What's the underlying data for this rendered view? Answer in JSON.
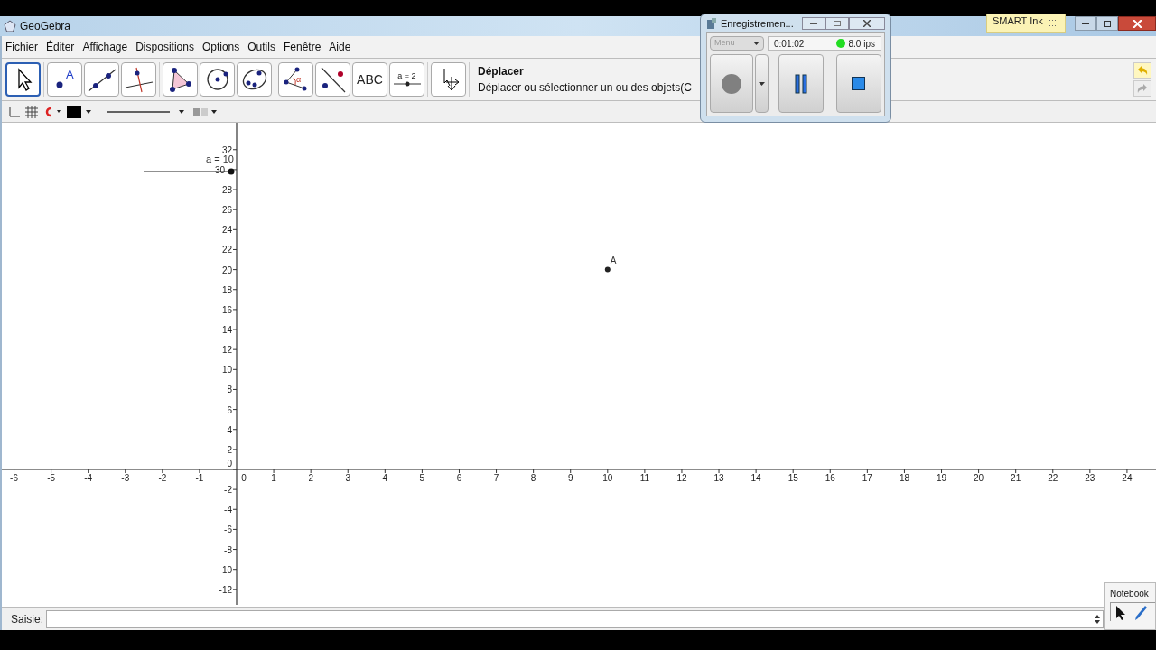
{
  "window": {
    "title": "GeoGebra"
  },
  "menu": [
    "Fichier",
    "Éditer",
    "Affichage",
    "Dispositions",
    "Options",
    "Outils",
    "Fenêtre",
    "Aide"
  ],
  "toolbar": {
    "tools": [
      {
        "kind": "move",
        "selected": true
      },
      {
        "kind": "point",
        "label": "A",
        "selected": false
      },
      {
        "kind": "line",
        "selected": false
      },
      {
        "kind": "perpendicular",
        "selected": false
      },
      {
        "kind": "polygon",
        "selected": false
      },
      {
        "kind": "circle",
        "selected": false
      },
      {
        "kind": "conic",
        "selected": false
      },
      {
        "kind": "angle",
        "label": "α",
        "selected": false
      },
      {
        "kind": "reflect",
        "selected": false
      },
      {
        "kind": "text",
        "label": "ABC",
        "selected": false
      },
      {
        "kind": "slider",
        "label": "a = 2",
        "selected": false
      },
      {
        "kind": "pan",
        "selected": false
      }
    ],
    "help_title": "Déplacer",
    "help_text": "Déplacer ou sélectionner un ou des objets(C"
  },
  "graphics": {
    "x_ticks": [
      "-6",
      "-5",
      "-4",
      "-3",
      "-2",
      "-1",
      "0",
      "1",
      "2",
      "3",
      "4",
      "5",
      "6",
      "7",
      "8",
      "9",
      "10",
      "11",
      "12",
      "13",
      "14",
      "15",
      "16",
      "17",
      "18",
      "19",
      "20",
      "21",
      "22",
      "23",
      "24"
    ],
    "y_ticks": [
      "32",
      "30",
      "28",
      "26",
      "24",
      "22",
      "20",
      "18",
      "16",
      "14",
      "12",
      "10",
      "8",
      "6",
      "4",
      "2",
      "0",
      "-2",
      "-4",
      "-6",
      "-8",
      "-10",
      "-12"
    ],
    "slider_label": "a = 10",
    "point_label": "A"
  },
  "input_bar": {
    "label": "Saisie:"
  },
  "recorder": {
    "title": "Enregistremen...",
    "menu": "Menu",
    "time": "0:01:02",
    "recording": true,
    "rate": "8.0 ips"
  },
  "smart_ink": {
    "label": "SMART Ink"
  },
  "notebook": {
    "label": "Notebook"
  }
}
